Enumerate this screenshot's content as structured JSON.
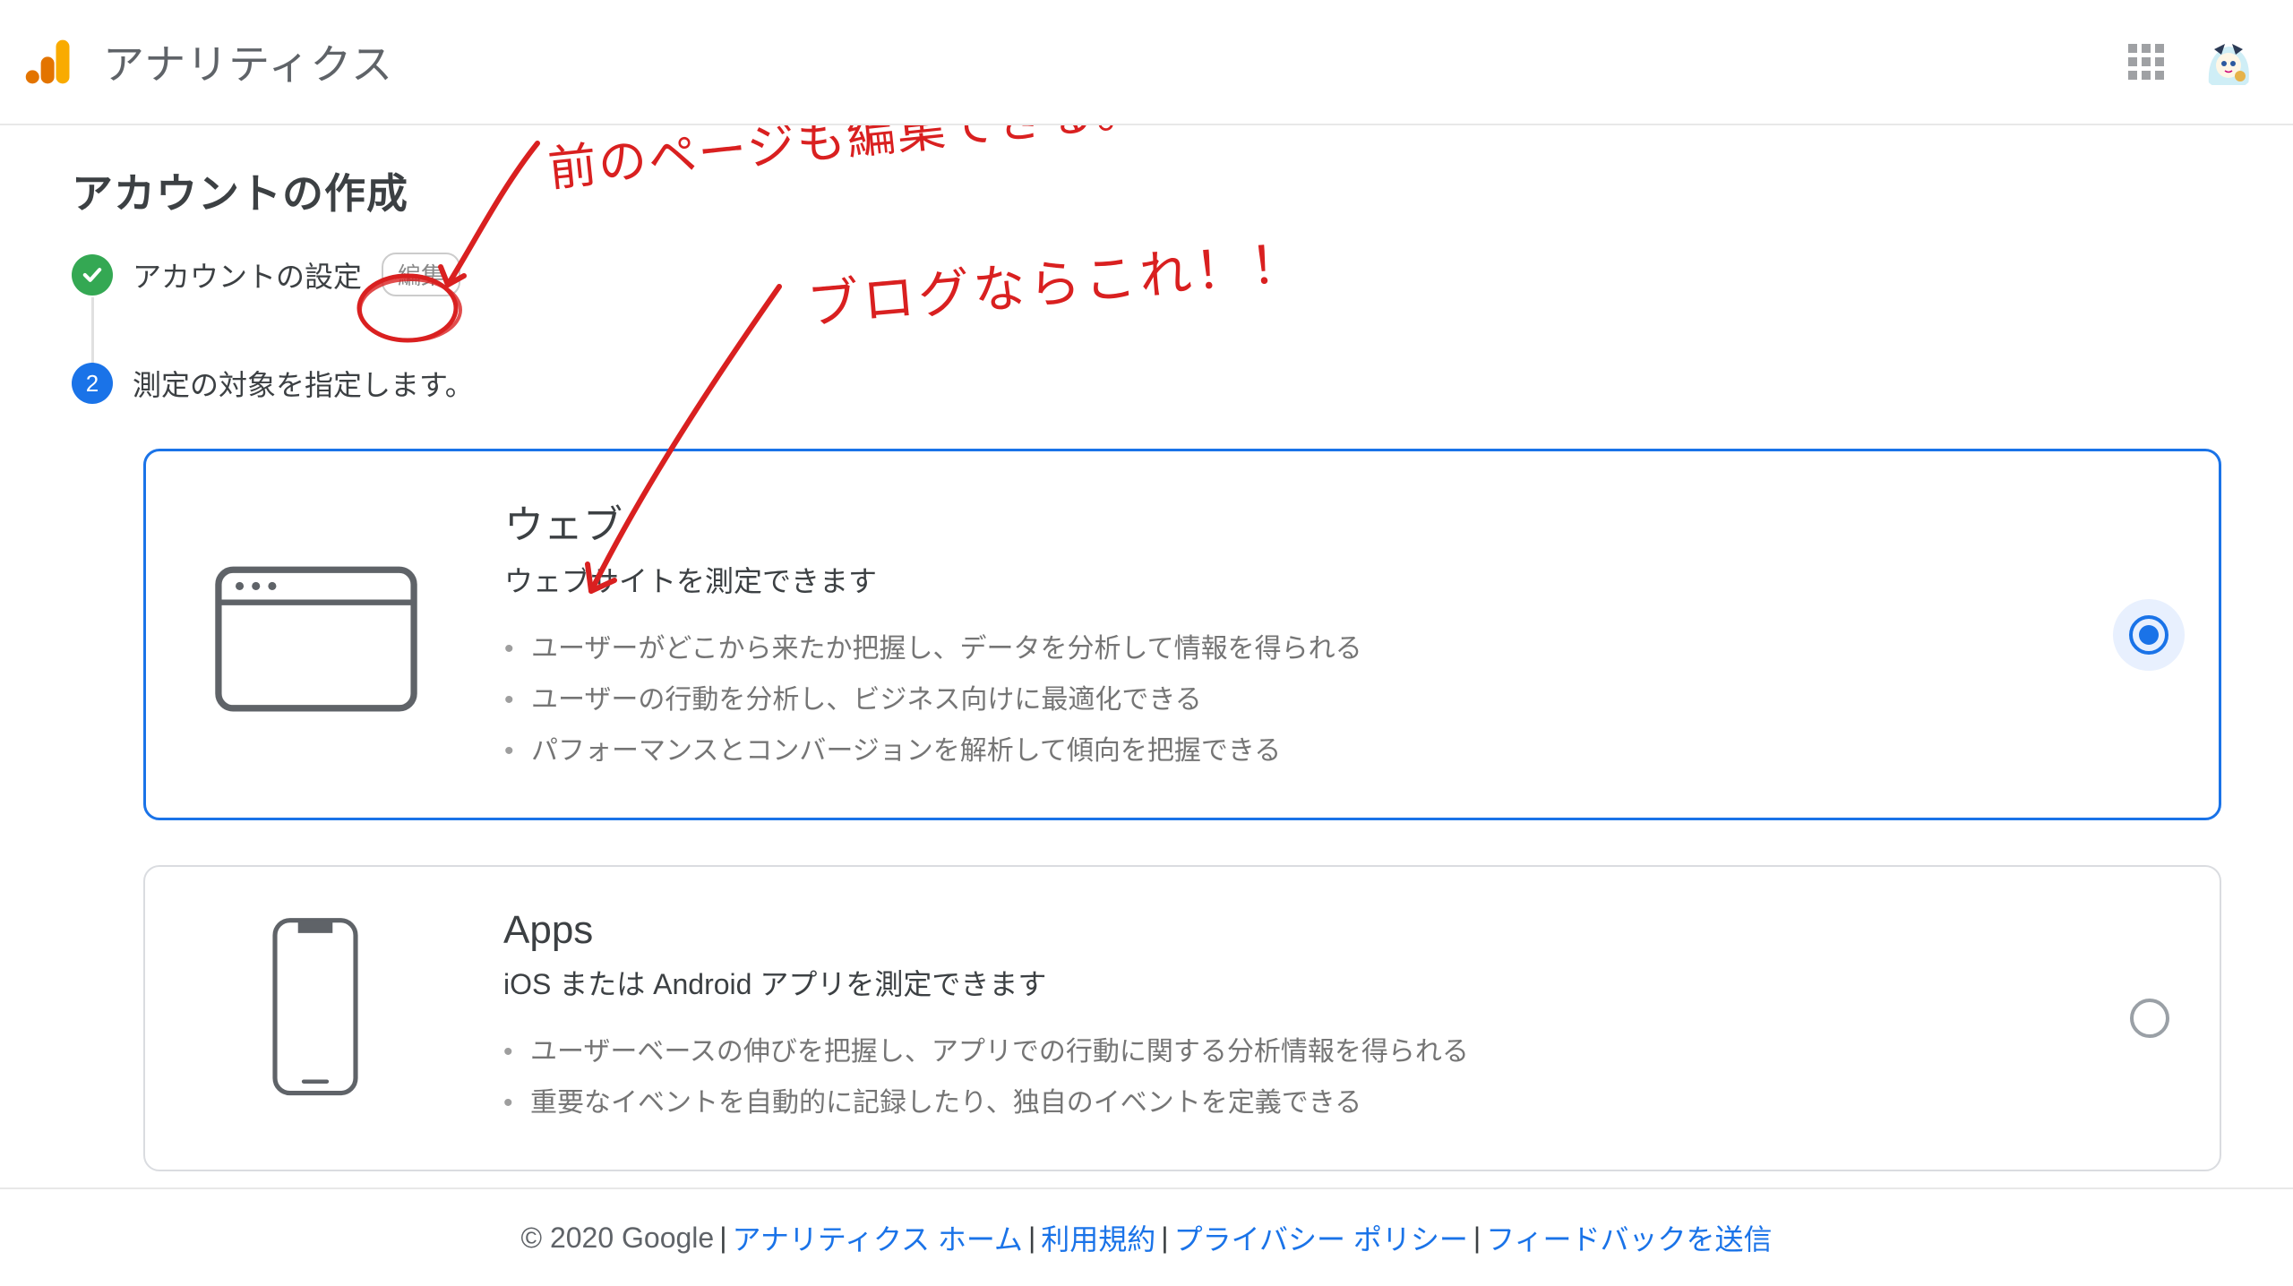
{
  "header": {
    "title": "アナリティクス"
  },
  "page": {
    "title": "アカウントの作成"
  },
  "steps": {
    "step1": {
      "label": "アカウントの設定",
      "edit": "編集"
    },
    "step2": {
      "number": "2",
      "label": "測定の対象を指定します。"
    }
  },
  "options": [
    {
      "id": "web",
      "title": "ウェブ",
      "subtitle": "ウェブサイトを測定できます",
      "bullets": [
        "ユーザーがどこから来たか把握し、データを分析して情報を得られる",
        "ユーザーの行動を分析し、ビジネス向けに最適化できる",
        "パフォーマンスとコンバージョンを解析して傾向を把握できる"
      ],
      "selected": true
    },
    {
      "id": "apps",
      "title": "Apps",
      "subtitle": "iOS または Android アプリを測定できます",
      "bullets": [
        "ユーザーベースの伸びを把握し、アプリでの行動に関する分析情報を得られる",
        "重要なイベントを自動的に記録したり、独自のイベントを定義できる"
      ],
      "selected": false
    }
  ],
  "footer": {
    "copyright": "© 2020 Google",
    "links": [
      "アナリティクス ホーム",
      "利用規約",
      "プライバシー ポリシー",
      "フィードバックを送信"
    ]
  },
  "annotations": {
    "note1": "前のページも編集できる。",
    "note2": "ブログならこれ！！"
  }
}
